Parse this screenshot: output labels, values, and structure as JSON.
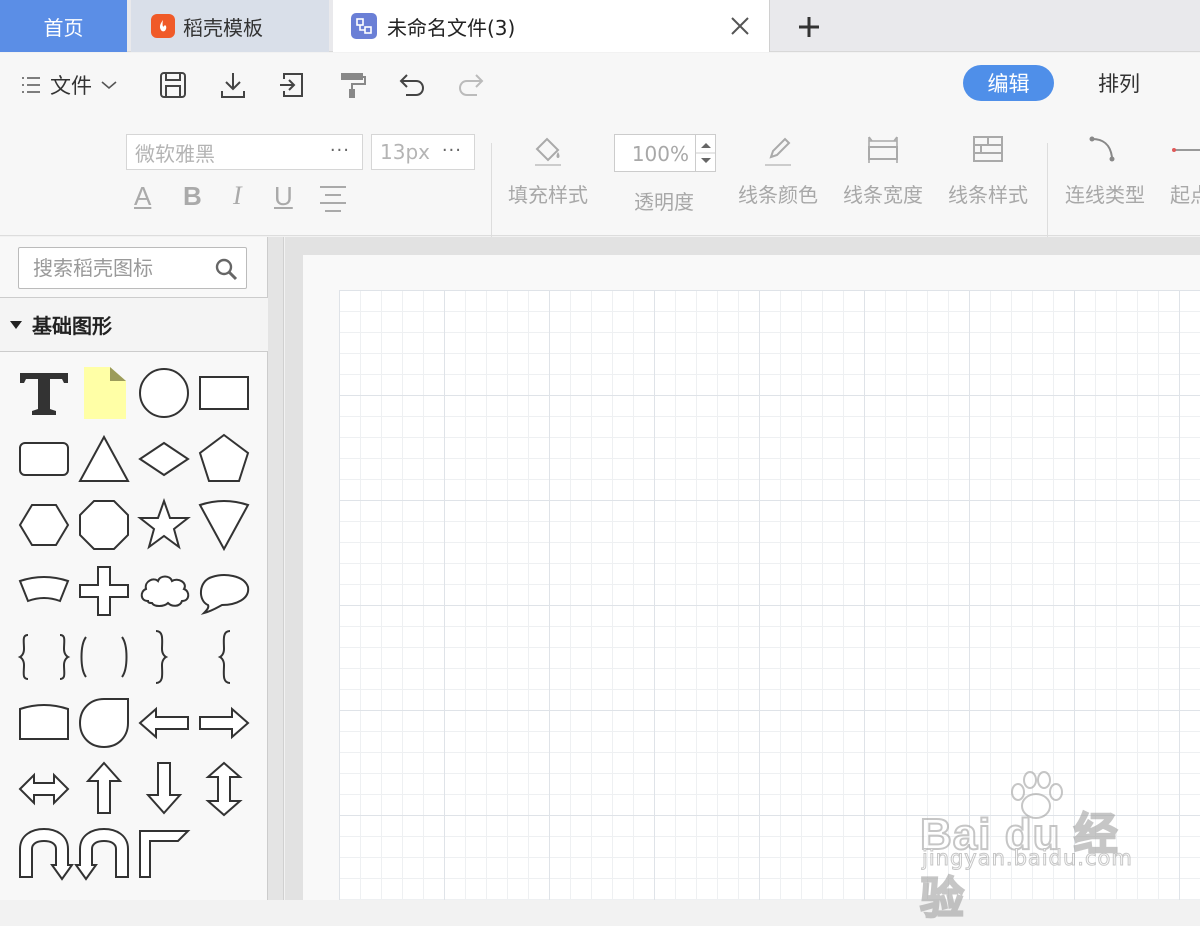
{
  "tabs": {
    "home_label": "首页",
    "templates_label": "稻壳模板",
    "document_label": "未命名文件(3)",
    "add_symbol": "+"
  },
  "toolbar": {
    "file_menu_label": "文件",
    "mode_edit_label": "编辑",
    "mode_arrange_label": "排列",
    "font_family_value": "微软雅黑",
    "font_size_value": "13px",
    "more_symbol": "···",
    "format_letters": [
      "A",
      "B",
      "I",
      "U"
    ],
    "opacity_value": "100%",
    "tools": {
      "fill_style": "填充样式",
      "opacity": "透明度",
      "line_color": "线条颜色",
      "line_width": "线条宽度",
      "line_style": "线条样式",
      "connector_type": "连线类型",
      "start_arrow": "起点"
    }
  },
  "sidebar": {
    "search_placeholder": "搜索稻壳图标",
    "section_title": "基础图形",
    "shape_names": [
      "text",
      "note",
      "circle",
      "rectangle",
      "rounded-rectangle",
      "triangle",
      "diamond",
      "pentagon",
      "hexagon",
      "octagon",
      "star",
      "inverted-triangle",
      "trapezoid-arc",
      "cross",
      "cloud",
      "speech-bubble",
      "braces",
      "brackets",
      "right-brace",
      "left-brace",
      "rounded-top-rect",
      "teardrop",
      "left-arrow",
      "right-arrow",
      "double-arrow",
      "up-arrow",
      "down-arrow",
      "up-down-arrow",
      "u-turn-down",
      "u-turn-arrow",
      "corner"
    ]
  },
  "watermark": {
    "brand": "Bai du 经验",
    "url": "jingyan.baidu.com"
  },
  "colors": {
    "home_tab": "#5b8ee6",
    "edit_button": "#4f8fe9",
    "templates_logo": "#f05a28",
    "document_logo": "#6a7fd6",
    "note_fill": "#ffffa6"
  }
}
